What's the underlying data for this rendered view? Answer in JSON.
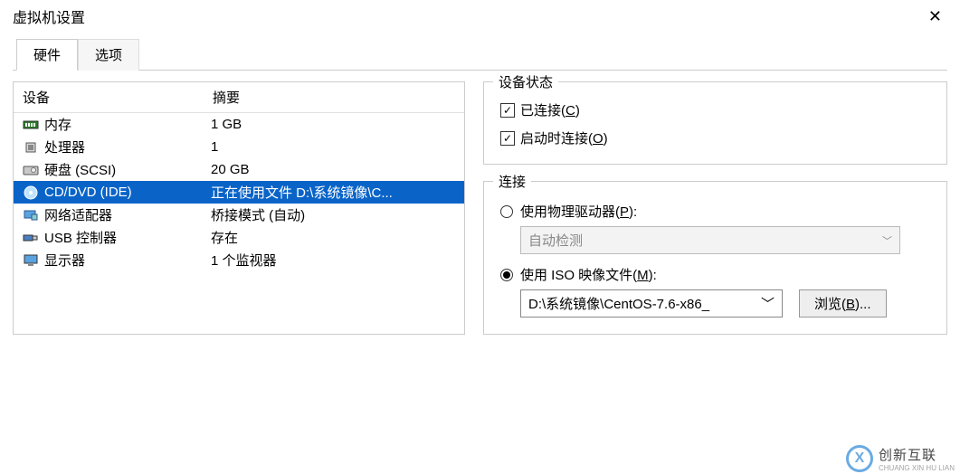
{
  "window": {
    "title": "虚拟机设置"
  },
  "tabs": {
    "hardware": "硬件",
    "options": "选项"
  },
  "headers": {
    "device": "设备",
    "summary": "摘要"
  },
  "devices": [
    {
      "icon": "memory",
      "name": "内存",
      "summary": "1 GB"
    },
    {
      "icon": "cpu",
      "name": "处理器",
      "summary": "1"
    },
    {
      "icon": "disk",
      "name": "硬盘 (SCSI)",
      "summary": "20 GB"
    },
    {
      "icon": "cd",
      "name": "CD/DVD (IDE)",
      "summary": "正在使用文件 D:\\系统镜像\\C..."
    },
    {
      "icon": "net",
      "name": "网络适配器",
      "summary": "桥接模式 (自动)"
    },
    {
      "icon": "usb",
      "name": "USB 控制器",
      "summary": "存在"
    },
    {
      "icon": "display",
      "name": "显示器",
      "summary": "1 个监视器"
    }
  ],
  "status": {
    "group": "设备状态",
    "connected_pre": "已连接(",
    "connected_u": "C",
    "connected_post": ")",
    "onstart_pre": "启动时连接(",
    "onstart_u": "O",
    "onstart_post": ")"
  },
  "connection": {
    "group": "连接",
    "physical_pre": "使用物理驱动器(",
    "physical_u": "P",
    "physical_post": "):",
    "autodetect": "自动检测",
    "iso_pre": "使用 ISO 映像文件(",
    "iso_u": "M",
    "iso_post": "):",
    "iso_path": "D:\\系统镜像\\CentOS-7.6-x86_",
    "browse_pre": "浏览(",
    "browse_u": "B",
    "browse_post": ")..."
  },
  "watermark": {
    "text": "创新互联",
    "sub": "CHUANG XIN HU LIAN",
    "logo_letter": "X"
  }
}
